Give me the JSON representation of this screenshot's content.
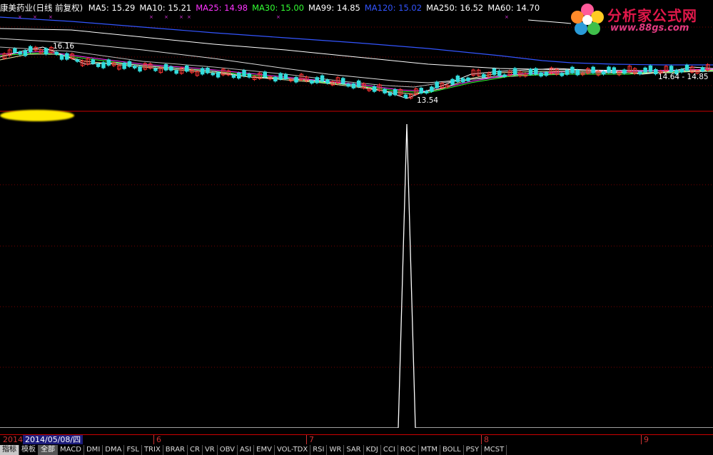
{
  "stock": {
    "title": "康美药业(日线 前复权)"
  },
  "ma_legend": [
    {
      "label": "MA5: 15.29",
      "color": "#ffffff"
    },
    {
      "label": "MA10: 15.21",
      "color": "#ffffff"
    },
    {
      "label": "MA25: 14.98",
      "color": "#ff33ff"
    },
    {
      "label": "MA30: 15.00",
      "color": "#33ff33"
    },
    {
      "label": "MA99: 14.85",
      "color": "#ffffff"
    },
    {
      "label": "MA120: 15.02",
      "color": "#3355ff"
    },
    {
      "label": "MA250: 16.52",
      "color": "#ffffff"
    },
    {
      "label": "MA60: 14.70",
      "color": "#ffffff"
    }
  ],
  "watermark": {
    "title": "分析家公式网",
    "url": "www.88gs.com"
  },
  "price_annotations": {
    "high": "16.16",
    "low": "13.54",
    "right": "14.64 - 14.85"
  },
  "date_bar": {
    "year": "2014",
    "current_date": "2014/05/08/四",
    "months": [
      "6",
      "7",
      "8",
      "9"
    ]
  },
  "tabs": [
    {
      "label": "指标",
      "kind": "mode"
    },
    {
      "label": "模板",
      "kind": "normal"
    },
    {
      "label": "全部",
      "kind": "active"
    },
    {
      "label": "MACD",
      "kind": "normal"
    },
    {
      "label": "DMI",
      "kind": "normal"
    },
    {
      "label": "DMA",
      "kind": "normal"
    },
    {
      "label": "FSL",
      "kind": "normal"
    },
    {
      "label": "TRIX",
      "kind": "normal"
    },
    {
      "label": "BRAR",
      "kind": "normal"
    },
    {
      "label": "CR",
      "kind": "normal"
    },
    {
      "label": "VR",
      "kind": "normal"
    },
    {
      "label": "OBV",
      "kind": "normal"
    },
    {
      "label": "ASI",
      "kind": "normal"
    },
    {
      "label": "EMV",
      "kind": "normal"
    },
    {
      "label": "VOL-TDX",
      "kind": "normal"
    },
    {
      "label": "RSI",
      "kind": "normal"
    },
    {
      "label": "WR",
      "kind": "normal"
    },
    {
      "label": "SAR",
      "kind": "normal"
    },
    {
      "label": "KDJ",
      "kind": "normal"
    },
    {
      "label": "CCI",
      "kind": "normal"
    },
    {
      "label": "ROC",
      "kind": "normal"
    },
    {
      "label": "MTM",
      "kind": "normal"
    },
    {
      "label": "BOLL",
      "kind": "normal"
    },
    {
      "label": "PSY",
      "kind": "normal"
    },
    {
      "label": "MCST",
      "kind": "normal"
    }
  ],
  "colors": {
    "background": "#000000",
    "up_candle": "#ff3333",
    "down_candle": "#33dddd",
    "divider": "#cc0000",
    "ma250": "#ffffff",
    "ma120": "#3355ff",
    "ma25": "#ff33ff",
    "ma30": "#33ff33"
  }
}
